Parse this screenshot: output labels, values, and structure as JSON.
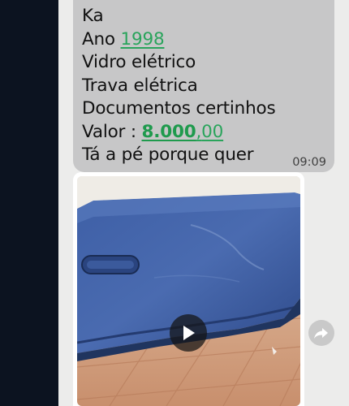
{
  "message": {
    "line_1": "Ka",
    "line_2_prefix": "Ano ",
    "line_2_year": "1998",
    "line_3": "Vidro elétrico",
    "line_4": "Trava elétrica",
    "line_5": "Documentos certinhos",
    "line_6_prefix": "Valor : ",
    "line_6_price_main": "8.000",
    "line_6_price_sep": ",",
    "line_6_price_cents": "00",
    "line_7": "Tá a pé porque quer",
    "time": "09:09"
  },
  "video": {
    "play_icon": "play-icon"
  },
  "actions": {
    "forward_icon": "forward-icon"
  },
  "colors": {
    "link": "#2aa45c",
    "bubble": "#c7c7c8",
    "sidebar": "#0c1320"
  }
}
